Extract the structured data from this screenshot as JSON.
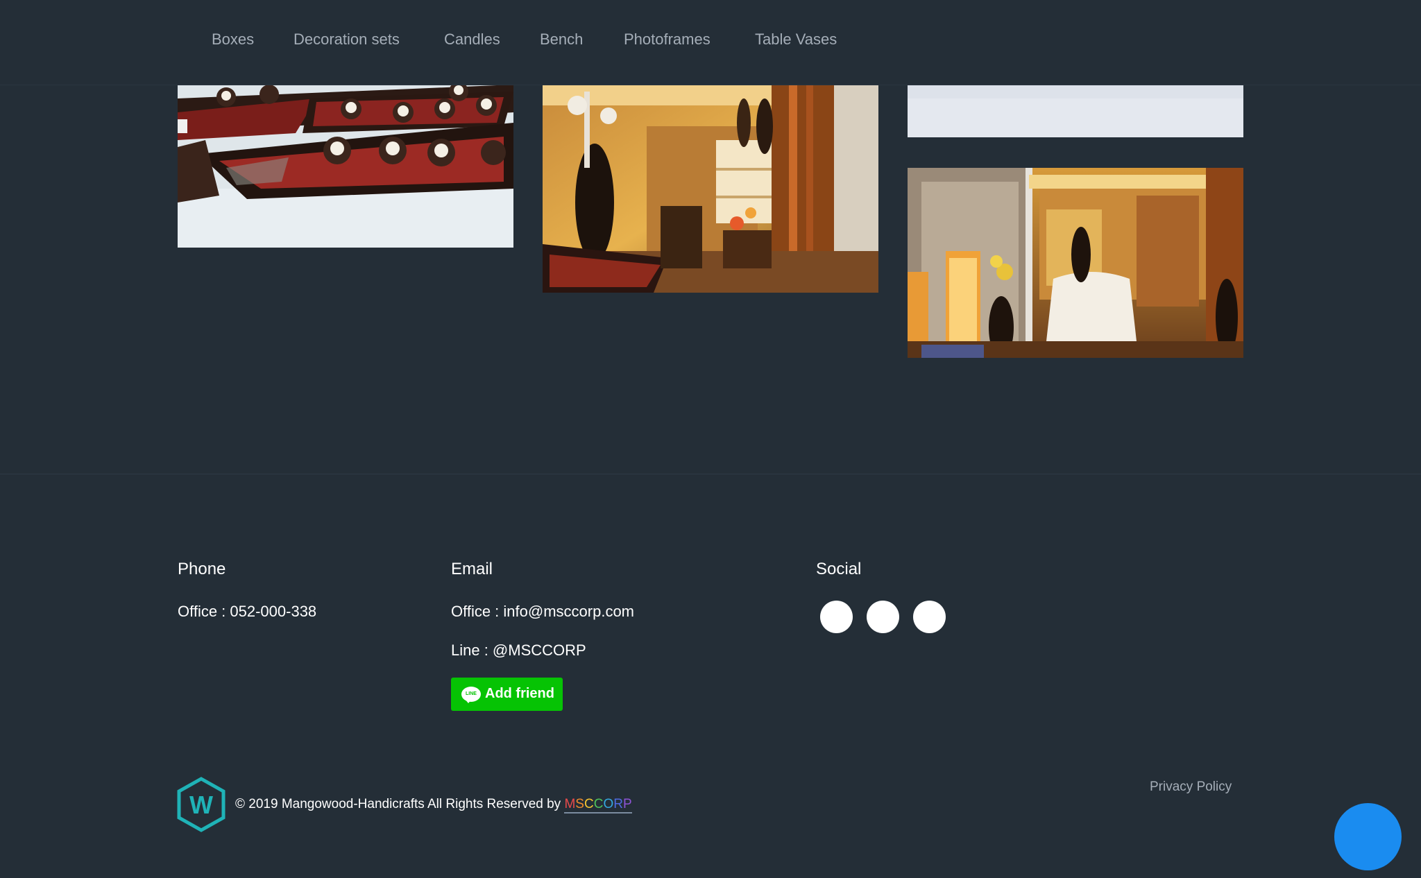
{
  "nav": {
    "items": [
      {
        "label": "Boxes"
      },
      {
        "label": "Decoration sets"
      },
      {
        "label": "Candles"
      },
      {
        "label": "Bench"
      },
      {
        "label": "Photoframes"
      },
      {
        "label": "Table Vases"
      }
    ]
  },
  "footer": {
    "phone": {
      "heading": "Phone",
      "office": "Office : 052-000-338"
    },
    "email": {
      "heading": "Email",
      "office": "Office : info@msccorp.com",
      "line": "Line : @MSCCORP",
      "add_friend_label": "Add friend",
      "line_badge": "LINE"
    },
    "social": {
      "heading": "Social"
    },
    "copyright": "© 2019 Mangowood-Handicrafts All Rights Reserved by",
    "brand": "MSCCORP",
    "brand_colors": [
      "#e94b4b",
      "#f08c2c",
      "#f4c531",
      "#4fc15a",
      "#35a8e0",
      "#4f6be0",
      "#8e54d6"
    ],
    "privacy_policy": "Privacy Policy"
  },
  "colors": {
    "background": "#242e37",
    "nav_text": "#a5aeb8",
    "line_green": "#06c304",
    "chat_blue": "#1a8cf0",
    "logo_teal": "#1fb3b7"
  },
  "icons": {
    "logo": "w-hexagon-logo",
    "line": "line-icon",
    "chat": "chat-bubble-icon"
  }
}
